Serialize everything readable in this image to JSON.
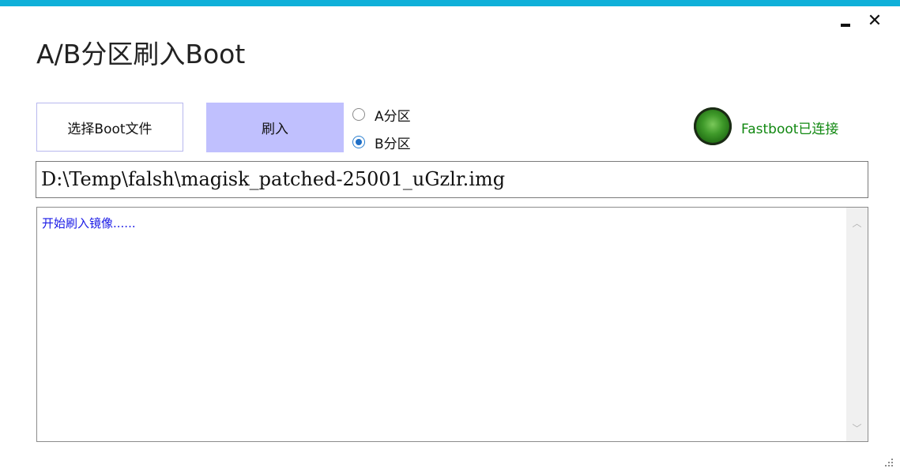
{
  "window": {
    "title": "A/B分区刷入Boot",
    "accent_color": "#0fb0d9",
    "minimize_icon": "minimize-icon",
    "close_label": "✕",
    "close_icon": "close-icon"
  },
  "toolbar": {
    "select_boot_label": "选择Boot文件",
    "flash_label": "刷入",
    "flash_button_color": "#c0c0fe"
  },
  "partition": {
    "options": [
      {
        "label": "A分区",
        "checked": false
      },
      {
        "label": "B分区",
        "checked": true
      }
    ]
  },
  "status": {
    "text": "Fastboot已连接",
    "color": "#118811",
    "indicator": "green-led",
    "connected": true
  },
  "file_path": {
    "value": "D:\\Temp\\falsh\\magisk_patched-25001_uGzlr.img"
  },
  "log": {
    "text": "开始刷入镜像......",
    "text_color": "#1a1ae6"
  },
  "scrollbar": {
    "up_icon": "chevron-up-icon",
    "down_icon": "chevron-down-icon",
    "up_glyph": "︿",
    "down_glyph": "﹀"
  }
}
